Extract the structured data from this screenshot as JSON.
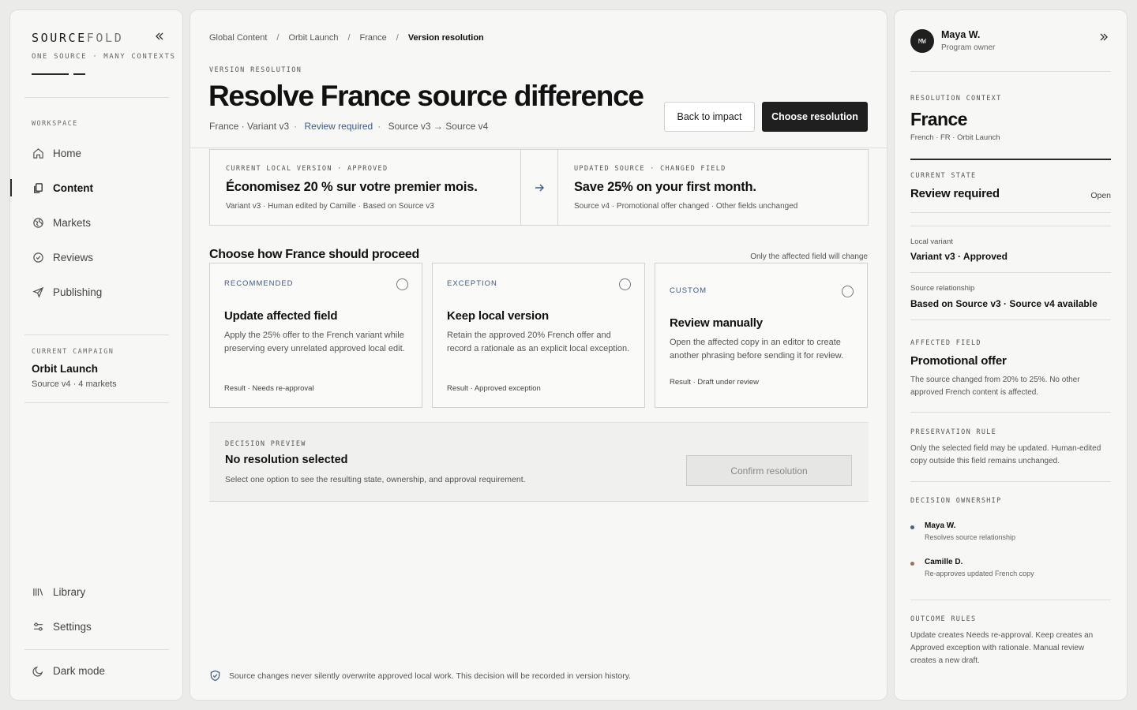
{
  "brand": {
    "name_dark": "SOURCE",
    "name_light": "FOLD",
    "tagline": "ONE SOURCE · MANY CONTEXTS"
  },
  "sidebar": {
    "section_label": "WORKSPACE",
    "items": [
      {
        "label": "Home",
        "icon": "home-icon"
      },
      {
        "label": "Content",
        "icon": "content-icon",
        "active": true
      },
      {
        "label": "Markets",
        "icon": "globe-icon"
      },
      {
        "label": "Reviews",
        "icon": "check-circle-icon"
      },
      {
        "label": "Publishing",
        "icon": "send-icon"
      }
    ],
    "campaign": {
      "label": "CURRENT CAMPAIGN",
      "name": "Orbit Launch",
      "meta": "Source v4 · 4 markets"
    },
    "bottom_items": [
      {
        "label": "Library",
        "icon": "library-icon"
      },
      {
        "label": "Settings",
        "icon": "sliders-icon"
      },
      {
        "label": "Dark mode",
        "icon": "moon-icon"
      }
    ]
  },
  "breadcrumb": [
    "Global Content",
    "Orbit Launch",
    "France",
    "Version resolution"
  ],
  "header": {
    "eyebrow": "VERSION RESOLUTION",
    "title": "Resolve France source difference",
    "sub_variant": "France · Variant v3",
    "sub_status": "Review required",
    "sub_source": "Source v3 → Source v4",
    "back_label": "Back to impact",
    "primary_label": "Choose resolution"
  },
  "comparison": {
    "left": {
      "eyebrow": "CURRENT LOCAL VERSION · APPROVED",
      "text": "Économisez 20 % sur votre premier mois.",
      "meta": "Variant v3 · Human edited by Camille · Based on Source v3"
    },
    "right": {
      "eyebrow": "UPDATED SOURCE · CHANGED FIELD",
      "text": "Save 25% on your first month.",
      "meta": "Source v4 · Promotional offer changed · Other fields unchanged"
    }
  },
  "options": {
    "title": "Choose how France should proceed",
    "note": "Only the affected field will change",
    "cards": [
      {
        "tag": "RECOMMENDED",
        "title": "Update affected field",
        "desc": "Apply the 25% offer to the French variant while preserving every unrelated approved local edit.",
        "result": "Result · Needs re-approval"
      },
      {
        "tag": "EXCEPTION",
        "title": "Keep local version",
        "desc": "Retain the approved 20% French offer and record a rationale as an explicit local exception.",
        "result": "Result · Approved exception"
      },
      {
        "tag": "CUSTOM",
        "title": "Review manually",
        "desc": "Open the affected copy in an editor to create another phrasing before sending it for review.",
        "result": "Result · Draft under review"
      }
    ]
  },
  "preview": {
    "eyebrow": "DECISION PREVIEW",
    "title": "No resolution selected",
    "desc": "Select one option to see the resulting state, ownership, and approval requirement.",
    "confirm_label": "Confirm resolution"
  },
  "footnote": "Source changes never silently overwrite approved local work. This decision will be recorded in version history.",
  "context": {
    "owner": {
      "initials": "MW",
      "name": "Maya W.",
      "role": "Program owner"
    },
    "resolution_label": "RESOLUTION CONTEXT",
    "market": "France",
    "market_meta": "French · FR · Orbit Launch",
    "state_label": "CURRENT STATE",
    "state_value": "Review required",
    "state_open": "Open",
    "local_variant_label": "Local variant",
    "local_variant_value": "Variant v3 · Approved",
    "source_rel_label": "Source relationship",
    "source_rel_value": "Based on Source v3 · Source v4 available",
    "affected_label": "AFFECTED FIELD",
    "affected_title": "Promotional offer",
    "affected_desc": "The source changed from 20% to 25%. No other approved French content is affected.",
    "preservation_label": "PRESERVATION RULE",
    "preservation_desc": "Only the selected field may be updated. Human-edited copy outside this field remains unchanged.",
    "ownership_label": "DECISION OWNERSHIP",
    "owners": [
      {
        "name": "Maya W.",
        "role": "Resolves source relationship",
        "color": "#4a5f82"
      },
      {
        "name": "Camille D.",
        "role": "Re-approves updated French copy",
        "color": "#9a7356"
      }
    ],
    "outcome_label": "OUTCOME RULES",
    "outcome_desc": "Update creates Needs re-approval. Keep creates an Approved exception with rationale. Manual review creates a new draft."
  }
}
